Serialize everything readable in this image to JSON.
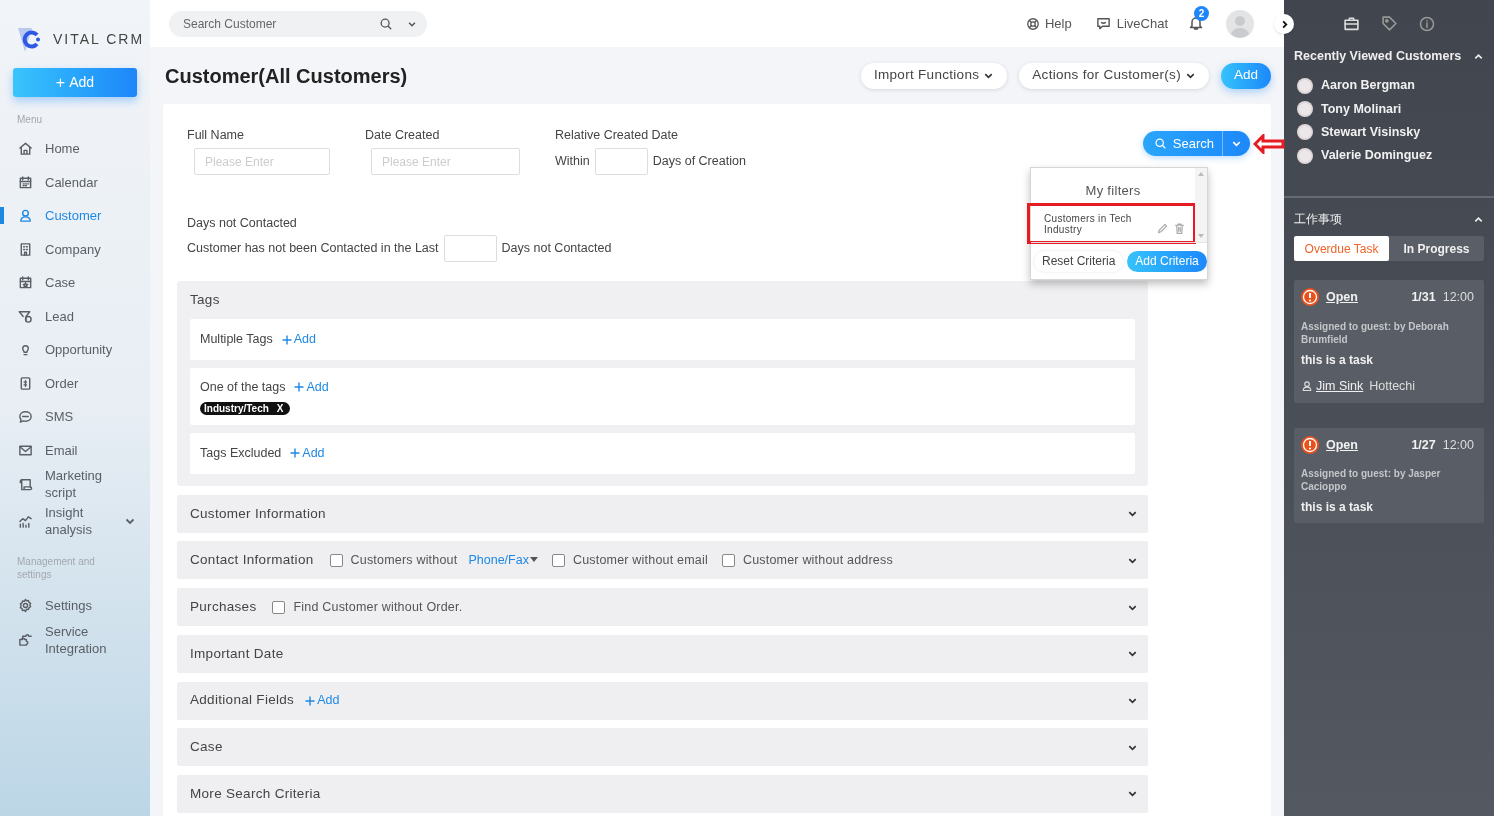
{
  "sidebar": {
    "logo": "VITAL CRM",
    "add_button": {
      "symbol": "+",
      "label": "Add"
    },
    "sections": [
      {
        "heading": "Menu",
        "items": [
          {
            "label": "Home",
            "selected": false,
            "has_submenu": false
          },
          {
            "label": "Calendar",
            "selected": false,
            "has_submenu": false
          },
          {
            "label": "Customer",
            "selected": true,
            "has_submenu": false
          },
          {
            "label": "Company",
            "selected": false,
            "has_submenu": false
          },
          {
            "label": "Case",
            "selected": false,
            "has_submenu": false
          },
          {
            "label": "Lead",
            "selected": false,
            "has_submenu": false
          },
          {
            "label": "Opportunity",
            "selected": false,
            "has_submenu": false
          },
          {
            "label": "Order",
            "selected": false,
            "has_submenu": false
          },
          {
            "label": "SMS",
            "selected": false,
            "has_submenu": false
          },
          {
            "label": "Email",
            "selected": false,
            "has_submenu": false
          },
          {
            "label": "Marketing script",
            "selected": false,
            "has_submenu": false
          },
          {
            "label": "Insight analysis",
            "selected": false,
            "has_submenu": true
          }
        ]
      },
      {
        "heading": "Management and settings",
        "items": [
          {
            "label": "Settings",
            "selected": false,
            "has_submenu": false
          },
          {
            "label": "Service Integration",
            "selected": false,
            "has_submenu": false
          }
        ]
      }
    ]
  },
  "topbar": {
    "search": {
      "placeholder": "Search Customer"
    },
    "help": "Help",
    "livechat": "LiveChat",
    "notifications": "2"
  },
  "page": {
    "title": "Customer(All Customers)",
    "actions": [
      {
        "label": "Import Functions",
        "kind": "dropdown"
      },
      {
        "label": "Actions for Customer(s)",
        "kind": "dropdown"
      },
      {
        "label": "Add",
        "kind": "primary"
      }
    ]
  },
  "filters": {
    "full_name": {
      "label": "Full Name",
      "placeholder": "Please Enter"
    },
    "date_created": {
      "label": "Date Created",
      "placeholder": "Please Enter"
    },
    "relative_created": {
      "label": "Relative Created Date",
      "prefix": "Within",
      "suffix": "Days of Creation"
    },
    "not_contacted": {
      "label": "Days not Contacted",
      "prefix": "Customer has not been Contacted in the Last",
      "suffix": "Days not Contacted"
    },
    "search_button": "Search"
  },
  "my_filters": {
    "title": "My filters",
    "items": [
      {
        "label": "Customers in Tech Industry",
        "highlighted": true
      }
    ],
    "reset": "Reset Criteria",
    "add": "Add Criteria"
  },
  "tags": {
    "title": "Tags",
    "rows": [
      {
        "label": "Multiple Tags",
        "add": "Add",
        "tags": []
      },
      {
        "label": "One of the tags",
        "add": "Add",
        "tags": [
          {
            "label": "Industry/Tech",
            "remove": "X"
          }
        ]
      },
      {
        "label": "Tags Excluded",
        "add": "Add",
        "tags": []
      }
    ]
  },
  "sections": [
    {
      "title": "Customer Information"
    },
    {
      "title": "Contact Information",
      "items": [
        {
          "kind": "checkbox",
          "label": "Customers without",
          "checked": false
        },
        {
          "kind": "link",
          "label": "Phone/Fax"
        },
        {
          "kind": "checkbox",
          "label": "Customer without email",
          "checked": false
        },
        {
          "kind": "checkbox",
          "label": "Customer without address",
          "checked": false
        }
      ]
    },
    {
      "title": "Purchases",
      "items": [
        {
          "kind": "checkbox",
          "label": "Find Customer without Order.",
          "checked": false
        }
      ]
    },
    {
      "title": "Important Date"
    },
    {
      "title": "Additional Fields",
      "items": [
        {
          "kind": "add",
          "label": "Add"
        }
      ]
    },
    {
      "title": "Case"
    },
    {
      "title": "More Search Criteria"
    }
  ],
  "right_panel": {
    "recent": {
      "title": "Recently Viewed Customers",
      "expanded": true,
      "customers": [
        "Aaron Bergman",
        "Tony Molinari",
        "Stewart Visinsky",
        "Valerie Dominguez"
      ]
    },
    "tasks": {
      "title": "工作事项",
      "expanded": true,
      "tabs": [
        {
          "label": "Overdue Task",
          "selected": true
        },
        {
          "label": "In Progress",
          "selected": false
        }
      ],
      "cards": [
        {
          "status": "Open",
          "date": "1/31",
          "time": "12:00",
          "assigned": "Assigned to guest: by Deborah Brumfield",
          "text": "this is a task",
          "contact": {
            "name": "Jim Sink",
            "company": "Hottechi"
          }
        },
        {
          "status": "Open",
          "date": "1/27",
          "time": "12:00",
          "assigned": "Assigned to guest: by Jasper Cacioppo",
          "text": "this is a task"
        }
      ]
    }
  }
}
